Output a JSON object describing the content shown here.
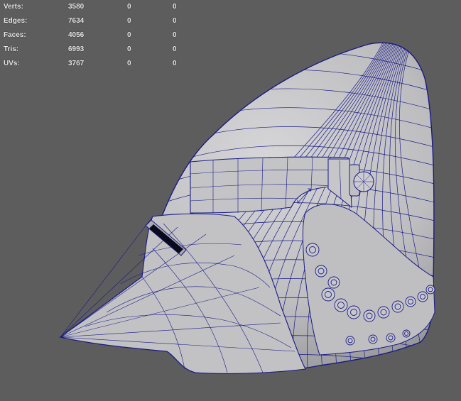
{
  "hud": {
    "rows": [
      {
        "label": "Verts:",
        "total": "3580",
        "selected": "0",
        "component": "0"
      },
      {
        "label": "Edges:",
        "total": "7634",
        "selected": "0",
        "component": "0"
      },
      {
        "label": "Faces:",
        "total": "4056",
        "selected": "0",
        "component": "0"
      },
      {
        "label": "Tris:",
        "total": "6993",
        "selected": "0",
        "component": "0"
      },
      {
        "label": "UVs:",
        "total": "3767",
        "selected": "0",
        "component": "0"
      }
    ]
  },
  "viewport": {
    "background_color": "#5d5d5d",
    "mesh_fill_color": "#c9c9cb",
    "wireframe_color": "#1a1a86",
    "mesh_subject": "medieval-great-helm-mesh"
  }
}
